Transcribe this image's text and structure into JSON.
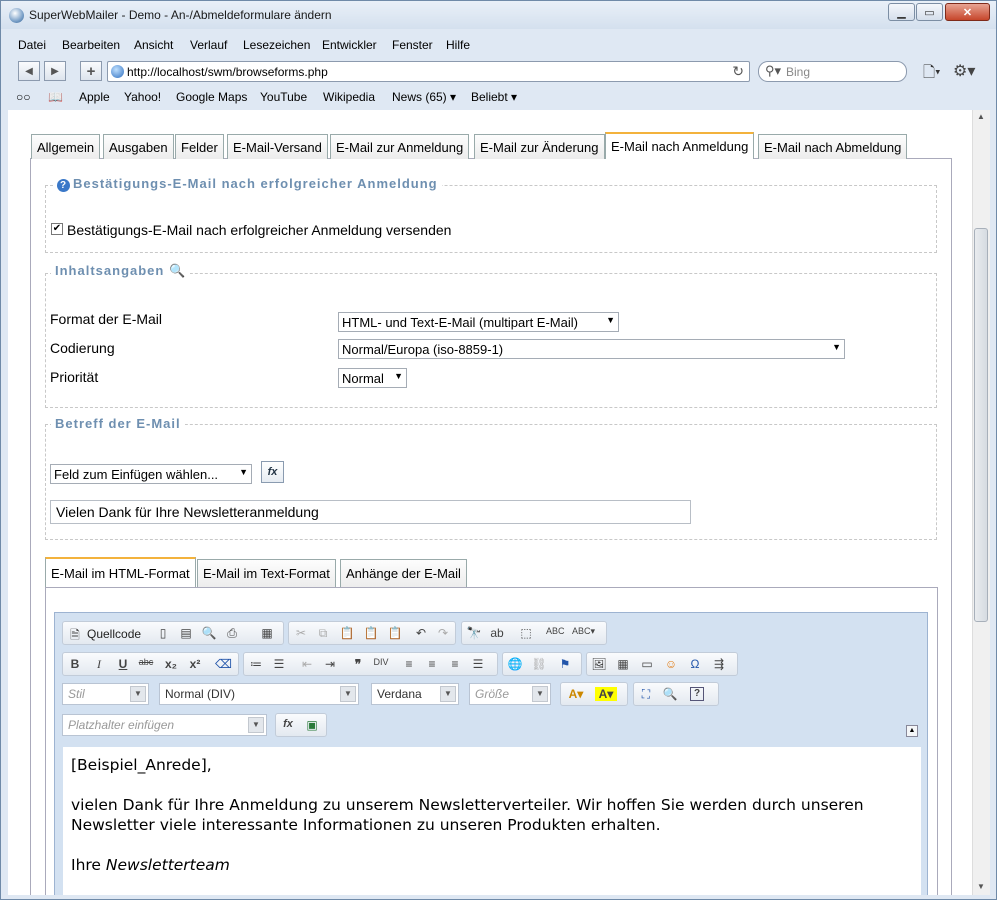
{
  "window": {
    "title": "SuperWebMailer - Demo - An-/Abmeldeformulare ändern"
  },
  "menu": [
    "Datei",
    "Bearbeiten",
    "Ansicht",
    "Verlauf",
    "Lesezeichen",
    "Entwickler",
    "Fenster",
    "Hilfe"
  ],
  "nav": {
    "url": "http://localhost/swm/browseforms.php",
    "search_placeholder": "Bing"
  },
  "bookmarks": [
    "Apple",
    "Yahoo!",
    "Google Maps",
    "YouTube",
    "Wikipedia",
    "News (65)",
    "Beliebt"
  ],
  "tabs": [
    "Allgemein",
    "Ausgaben",
    "Felder",
    "E-Mail-Versand",
    "E-Mail zur Anmeldung",
    "E-Mail zur Änderung",
    "E-Mail nach Anmeldung",
    "E-Mail nach Abmeldung"
  ],
  "confirm": {
    "legend": "Bestätigungs-E-Mail nach erfolgreicher Anmeldung",
    "checkbox_label": "Bestätigungs-E-Mail nach erfolgreicher Anmeldung versenden",
    "checked": true
  },
  "content_info": {
    "legend": "Inhaltsangaben",
    "format_label": "Format der E-Mail",
    "format_value": "HTML- und Text-E-Mail (multipart E-Mail)",
    "encoding_label": "Codierung",
    "encoding_value": "Normal/Europa (iso-8859-1)",
    "priority_label": "Priorität",
    "priority_value": "Normal"
  },
  "subject": {
    "legend": "Betreff der E-Mail",
    "field_select": "Feld zum Einfügen wählen...",
    "fx": "fx",
    "value": "Vielen Dank für Ihre Newsletteranmeldung"
  },
  "subtabs": [
    "E-Mail im HTML-Format",
    "E-Mail im Text-Format",
    "Anhänge der E-Mail"
  ],
  "editor": {
    "source_label": "Quellcode",
    "style_combo": "Stil",
    "format_combo": "Normal (DIV)",
    "font_combo": "Verdana",
    "size_combo": "Größe",
    "placeholder_combo": "Platzhalter einfügen",
    "fx": "fx",
    "line1": "[Beispiel_Anrede],",
    "line2": "vielen Dank für Ihre Anmeldung zu unserem Newsletterverteiler. Wir hoffen Sie werden durch unseren Newsletter viele interessante Informationen zu unseren Produkten erhalten.",
    "line3_prefix": "Ihre ",
    "line3_em": "Newsletterteam"
  }
}
